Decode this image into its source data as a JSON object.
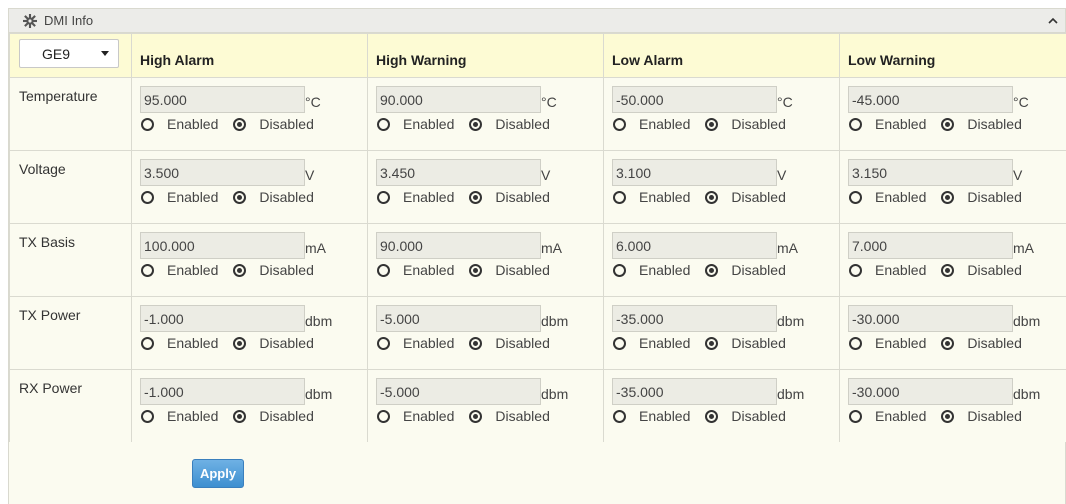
{
  "panel": {
    "title": "DMI Info",
    "icon": "gear-icon",
    "collapse_icon": "chevron-up-icon"
  },
  "port_select": {
    "value": "GE9"
  },
  "columns": [
    "High Alarm",
    "High Warning",
    "Low Alarm",
    "Low Warning"
  ],
  "radio_labels": {
    "enabled": "Enabled",
    "disabled": "Disabled"
  },
  "rows": [
    {
      "label": "Temperature",
      "unit": "°C",
      "values": [
        "95.000",
        "90.000",
        "-50.000",
        "-45.000"
      ],
      "state": [
        "Disabled",
        "Disabled",
        "Disabled",
        "Disabled"
      ]
    },
    {
      "label": "Voltage",
      "unit": "V",
      "values": [
        "3.500",
        "3.450",
        "3.100",
        "3.150"
      ],
      "state": [
        "Disabled",
        "Disabled",
        "Disabled",
        "Disabled"
      ]
    },
    {
      "label": "TX Basis",
      "unit": "mA",
      "values": [
        "100.000",
        "90.000",
        "6.000",
        "7.000"
      ],
      "state": [
        "Disabled",
        "Disabled",
        "Disabled",
        "Disabled"
      ]
    },
    {
      "label": "TX Power",
      "unit": "dbm",
      "values": [
        "-1.000",
        "-5.000",
        "-35.000",
        "-30.000"
      ],
      "state": [
        "Disabled",
        "Disabled",
        "Disabled",
        "Disabled"
      ]
    },
    {
      "label": "RX Power",
      "unit": "dbm",
      "values": [
        "-1.000",
        "-5.000",
        "-35.000",
        "-30.000"
      ],
      "state": [
        "Disabled",
        "Disabled",
        "Disabled",
        "Disabled"
      ]
    }
  ],
  "apply_label": "Apply",
  "colors": {
    "header_bg": "#fdfbd4",
    "panel_bg": "#fbfbf0",
    "button": "#4a98d6"
  }
}
